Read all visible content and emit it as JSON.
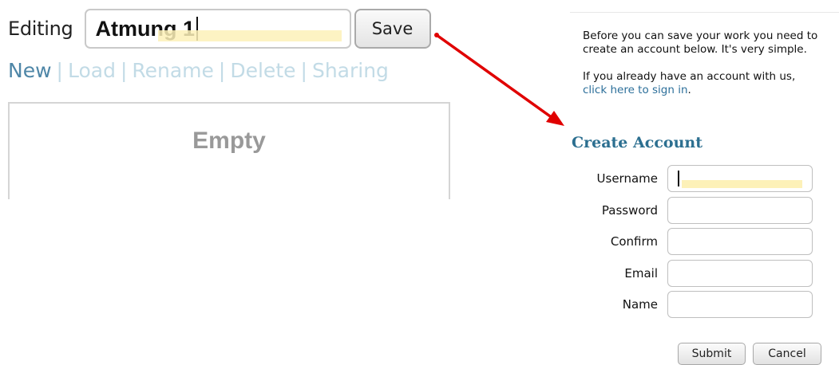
{
  "editor": {
    "editing_label": "Editing",
    "name_value": "Atmung 1",
    "save_label": "Save"
  },
  "nav": {
    "new": "New",
    "load": "Load",
    "rename": "Rename",
    "delete": "Delete",
    "sharing": "Sharing",
    "separator": "|"
  },
  "panel": {
    "empty_text": "Empty"
  },
  "account": {
    "intro_text": "Before you can save your work you need to create an account below. It's very simple.",
    "existing_text": "If you already have an account with us,",
    "signin_link": "click here to sign in",
    "signin_suffix": ".",
    "title": "Create Account",
    "fields": {
      "username": {
        "label": "Username",
        "value": ""
      },
      "password": {
        "label": "Password",
        "value": ""
      },
      "confirm": {
        "label": "Confirm",
        "value": ""
      },
      "email": {
        "label": "Email",
        "value": ""
      },
      "name": {
        "label": "Name",
        "value": ""
      }
    },
    "submit_label": "Submit",
    "cancel_label": "Cancel"
  },
  "colors": {
    "arrow": "#e00000",
    "link_active": "#4e86a7",
    "link_inactive": "#c2dbe6",
    "title": "#2c6f90",
    "signin_link": "#2c6f9a",
    "field_highlight": "#fdf1b8"
  },
  "icons": {
    "arrow": "red-arrow-icon"
  }
}
